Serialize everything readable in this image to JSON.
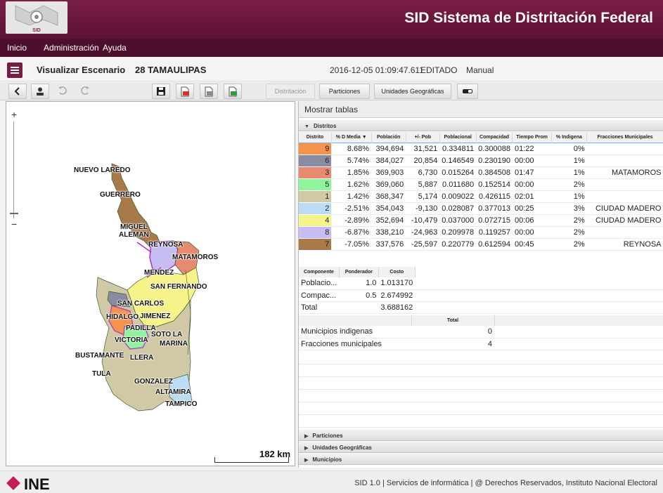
{
  "header": {
    "app_title": "SID Sistema de Distritación Federal",
    "logo_text": "SID"
  },
  "menu": {
    "items": [
      "Inicio",
      "Administración",
      "Ayuda"
    ]
  },
  "titlebar": {
    "title": "Visualizar Escenario",
    "state": "28 TAMAULIPAS",
    "timestamp": "2016-12-05 01:09:47.611",
    "status": "EDITADO",
    "mode": "Manual"
  },
  "toolbar": {
    "distritacion": "Distritación",
    "particiones": "Particiones",
    "unidades": "Unidades Geográficas",
    "icons": [
      "back-icon",
      "user-icon",
      "undo-icon",
      "redo-icon",
      "save-icon",
      "export-pdf-icon",
      "export-doc-icon",
      "export-excel-icon",
      "eraser-icon"
    ]
  },
  "map": {
    "zoom_in": "+",
    "zoom_out": "−",
    "scale": "182 km",
    "places": [
      "NUEVO LAREDO",
      "GUERRERO",
      "MIGUEL ALEMAN",
      "REYNOSA",
      "MATAMOROS",
      "MENDEZ",
      "SAN FERNANDO",
      "SAN CARLOS",
      "HIDALGO",
      "JIMENEZ",
      "PADILLA",
      "SOTO LA MARINA",
      "VICTORIA",
      "BUSTAMANTE",
      "LLERA",
      "TULA",
      "GONZALEZ",
      "ALTAMIRA",
      "TAMPICO"
    ]
  },
  "panel": {
    "mostrar_tablas": "Mostrar tablas",
    "distritos": {
      "title": "Distritos",
      "columns": [
        "Distrito",
        "% D Media ▼",
        "Población",
        "+/- Pob",
        "Poblacional",
        "Compacidad",
        "Tiempo Prom",
        "% Indigena",
        "Fracciones Municipales"
      ],
      "rows": [
        {
          "color": "#f4934b",
          "distrito": "9",
          "dmedia": "8.68%",
          "poblacion": "394,694",
          "pob": "31,521",
          "poblacional": "0.334811",
          "compacidad": "0.300088",
          "tiempo": "01:22",
          "indigena": "0%",
          "fracciones": ""
        },
        {
          "color": "#8b8aa3",
          "distrito": "6",
          "dmedia": "5.74%",
          "poblacion": "384,027",
          "pob": "20,854",
          "poblacional": "0.146549",
          "compacidad": "0.230190",
          "tiempo": "00:00",
          "indigena": "1%",
          "fracciones": ""
        },
        {
          "color": "#e88a70",
          "distrito": "3",
          "dmedia": "1.85%",
          "poblacion": "369,903",
          "pob": "6,730",
          "poblacional": "0.015264",
          "compacidad": "0.384508",
          "tiempo": "01:47",
          "indigena": "1%",
          "fracciones": "MATAMOROS"
        },
        {
          "color": "#8ef59c",
          "distrito": "5",
          "dmedia": "1.62%",
          "poblacion": "369,060",
          "pob": "5,887",
          "poblacional": "0.011680",
          "compacidad": "0.152514",
          "tiempo": "00:00",
          "indigena": "2%",
          "fracciones": ""
        },
        {
          "color": "#d1c8a6",
          "distrito": "1",
          "dmedia": "1.42%",
          "poblacion": "368,347",
          "pob": "5,174",
          "poblacional": "0.009022",
          "compacidad": "0.426115",
          "tiempo": "02:01",
          "indigena": "1%",
          "fracciones": ""
        },
        {
          "color": "#bcdcf5",
          "distrito": "2",
          "dmedia": "-2.51%",
          "poblacion": "354,043",
          "pob": "-9,130",
          "poblacional": "0.028087",
          "compacidad": "0.377013",
          "tiempo": "00:25",
          "indigena": "3%",
          "fracciones": "CIUDAD MADERO"
        },
        {
          "color": "#f6f38a",
          "distrito": "4",
          "dmedia": "-2.89%",
          "poblacion": "352,694",
          "pob": "-10,479",
          "poblacional": "0.037000",
          "compacidad": "0.072715",
          "tiempo": "00:06",
          "indigena": "2%",
          "fracciones": "CIUDAD MADERO"
        },
        {
          "color": "#c8bdf2",
          "distrito": "8",
          "dmedia": "-6.87%",
          "poblacion": "338,210",
          "pob": "-24,963",
          "poblacional": "0.209978",
          "compacidad": "0.119257",
          "tiempo": "00:00",
          "indigena": "2%",
          "fracciones": ""
        },
        {
          "color": "#a87a4a",
          "distrito": "7",
          "dmedia": "-7.05%",
          "poblacion": "337,576",
          "pob": "-25,597",
          "poblacional": "0.220779",
          "compacidad": "0.612594",
          "tiempo": "00:45",
          "indigena": "2%",
          "fracciones": "REYNOSA"
        }
      ]
    },
    "componentes": {
      "columns": [
        "Componente",
        "Ponderador",
        "Costo"
      ],
      "rows": [
        {
          "componente": "Poblacio...",
          "ponderador": "1.0",
          "costo": "1.013170"
        },
        {
          "componente": "Compac...",
          "ponderador": "0.5",
          "costo": "2.674992"
        },
        {
          "componente": "Total",
          "ponderador": "",
          "costo": "3.688162"
        }
      ]
    },
    "totales": {
      "column": "Total",
      "rows": [
        {
          "label": "Municipios indigenas",
          "value": "0"
        },
        {
          "label": "Fracciones municipales",
          "value": "4"
        }
      ]
    },
    "sections": [
      "Particiones",
      "Unidades Geográficas",
      "Municipios"
    ]
  },
  "footer": {
    "logo": "INE",
    "text": "SID 1.0 | Servicios de informática | @ Derechos Reservados, Instituto Nacional Electoral"
  }
}
